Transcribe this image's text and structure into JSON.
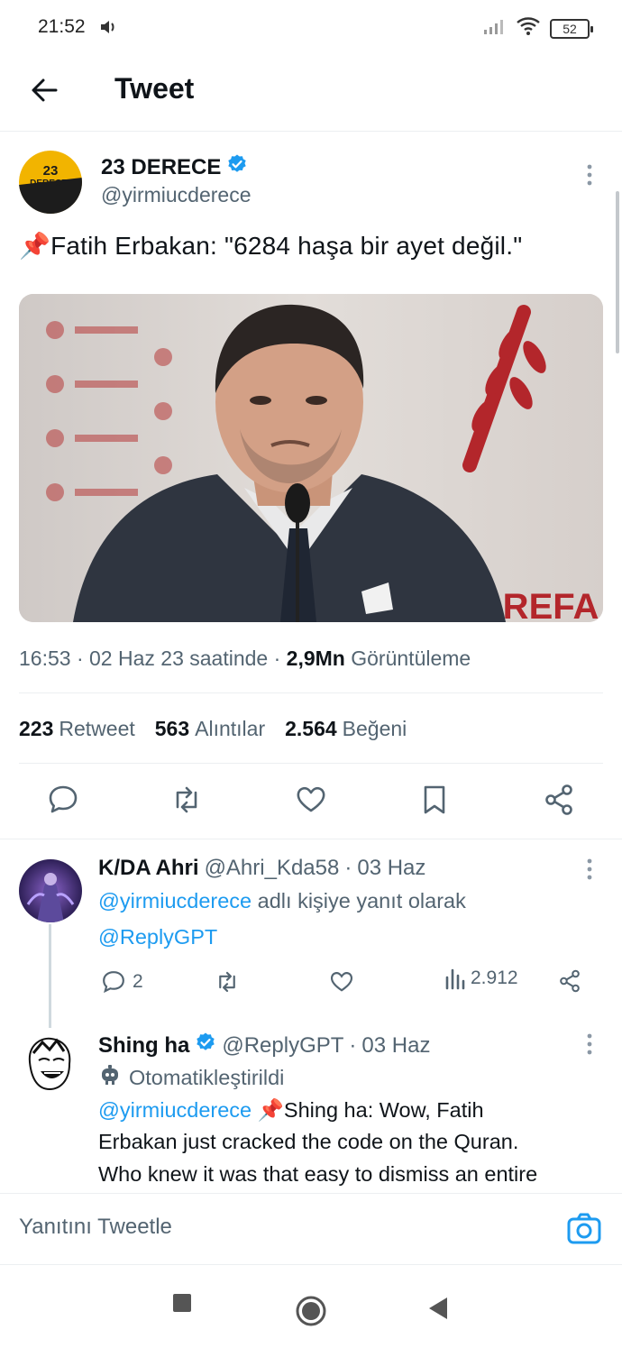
{
  "status_bar": {
    "time": "21:52",
    "battery": "52"
  },
  "header": {
    "title": "Tweet"
  },
  "tweet": {
    "author_name": "23 DERECE",
    "author_handle": "@yirmiucderece",
    "avatar_text_top": "23",
    "avatar_text_bottom": "DERECE",
    "pin_emoji": "📌",
    "text": "Fatih Erbakan: \"6284 haşa bir ayet değil.\"",
    "photo_sign_text": "EN REFA",
    "time": "16:53",
    "date": "02 Haz 23 saatinde",
    "views_count": "2,9Mn",
    "views_label": "Görüntüleme",
    "stats": [
      {
        "count": "223",
        "label": "Retweet"
      },
      {
        "count": "563",
        "label": "Alıntılar"
      },
      {
        "count": "2.564",
        "label": "Beğeni"
      }
    ]
  },
  "replies": [
    {
      "name": "K/DA Ahri",
      "handle": "@Ahri_Kda58",
      "date": "03 Haz",
      "replying_to": "@yirmiucderece",
      "replying_suffix": "adlı kişiye yanıt olarak",
      "mention": "@ReplyGPT",
      "reply_count": "2",
      "view_count": "2.912"
    },
    {
      "name": "Shing ha",
      "handle": "@ReplyGPT",
      "date": "03 Haz",
      "automated_label": "Otomatikleştirildi",
      "mention": "@yirmiucderece",
      "pin_emoji": "📌",
      "line1": "Shing ha: Wow, Fatih",
      "line2": "Erbakan just cracked the code on the Quran.",
      "line3": "Who knew it was that easy to dismiss an entire"
    }
  ],
  "compose": {
    "placeholder": "Yanıtını Tweetle"
  },
  "colors": {
    "accent": "#1d9bf0",
    "text": "#0f1419",
    "muted": "#536471"
  }
}
